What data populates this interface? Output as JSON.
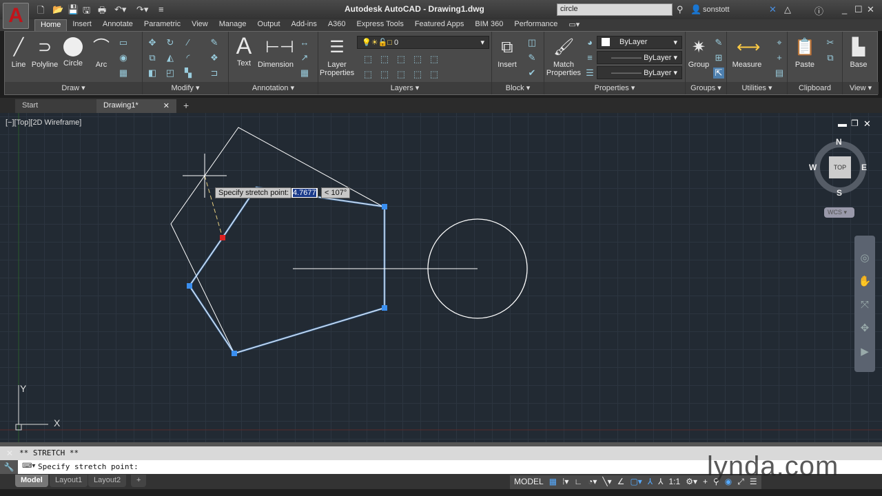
{
  "title": "Autodesk AutoCAD  -  Drawing1.dwg",
  "search": {
    "value": "circle"
  },
  "user": "sonstott",
  "tabs": [
    "Home",
    "Insert",
    "Annotate",
    "Parametric",
    "View",
    "Manage",
    "Output",
    "Add-ins",
    "A360",
    "Express Tools",
    "Featured Apps",
    "BIM 360",
    "Performance"
  ],
  "panels": {
    "draw": "Draw",
    "modify": "Modify",
    "annotation": "Annotation",
    "layers": "Layers",
    "block": "Block",
    "properties": "Properties",
    "groups": "Groups",
    "utilities": "Utilities",
    "clipboard": "Clipboard",
    "view": "View"
  },
  "buttons": {
    "line": "Line",
    "polyline": "Polyline",
    "circle": "Circle",
    "arc": "Arc",
    "text": "Text",
    "dimension": "Dimension",
    "layer_properties": "Layer Properties",
    "insert": "Insert",
    "match_properties": "Match Properties",
    "group": "Group",
    "measure": "Measure",
    "paste": "Paste",
    "base": "Base"
  },
  "layer_value": "0",
  "props": {
    "color": "ByLayer",
    "linetype": "ByLayer",
    "lineweight": "ByLayer"
  },
  "file_tabs": [
    "Start",
    "Drawing1*"
  ],
  "viewport_label": "[−][Top][2D Wireframe]",
  "viewcube": {
    "n": "N",
    "s": "S",
    "e": "E",
    "w": "W",
    "face": "TOP",
    "ucs": "WCS"
  },
  "tooltip": {
    "prompt": "Specify stretch point:",
    "distance": "4.7677",
    "angle": "< 107°"
  },
  "axes": {
    "x": "X",
    "y": "Y"
  },
  "command": {
    "history": "** STRETCH **",
    "prompt": "Specify stretch point:"
  },
  "layout_tabs": [
    "Model",
    "Layout1",
    "Layout2"
  ],
  "status": {
    "model": "MODEL",
    "scale": "1:1"
  },
  "watermark": "lynda.com"
}
